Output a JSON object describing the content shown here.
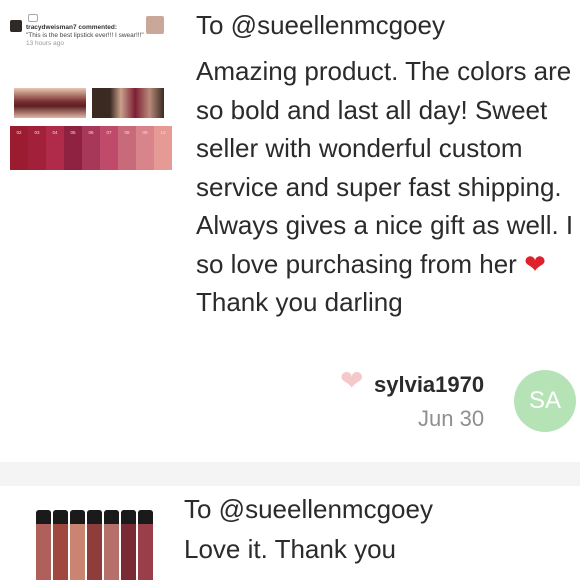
{
  "reviews": [
    {
      "recipient": "To @sueellenmcgoey",
      "message": "Amazing product. The colors are so bold and last all day! Sweet seller with wonderful custom service and super fast shipping. Always gives a nice gift as well. I so love purchasing from her",
      "message_end": "Thank you darling",
      "heart_emoji": "❤",
      "like_icon": "heart-icon",
      "reviewer": "sylvia1970",
      "date": "Jun 30",
      "avatar_initials": "SA",
      "avatar_color": "#b6e3b6",
      "thumbnail": {
        "commenter": "tracydweisman7 commented:",
        "comment": "\"This is the best lipstick ever!!! I swear!!!\"",
        "time_ago": "13 hours ago",
        "swatch_labels": [
          "02",
          "03",
          "04",
          "05",
          "06",
          "07",
          "08",
          "09",
          "10"
        ]
      }
    },
    {
      "recipient": "To @sueellenmcgoey",
      "message": "Love it. Thank you"
    }
  ],
  "colors": {
    "text": "#2b2b2b",
    "muted": "#8f8f8f",
    "heart_red": "#e0202a",
    "heart_pink": "#f5c9c9",
    "divider": "#f4f4f4"
  }
}
